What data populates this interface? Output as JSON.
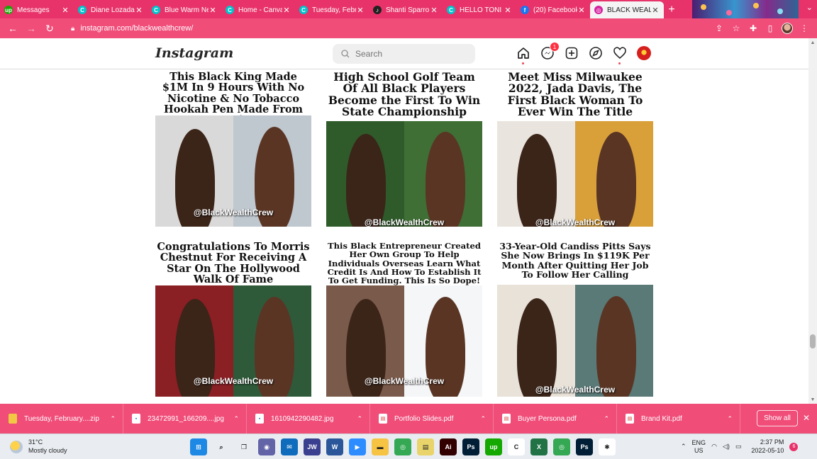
{
  "browser": {
    "tabs": [
      {
        "label": "Messages",
        "favicon": "upwork-icon",
        "color": "#14a800",
        "glyph": "up"
      },
      {
        "label": "Diane Lozada",
        "favicon": "canva-icon",
        "color": "#00c4cc",
        "glyph": "C"
      },
      {
        "label": "Blue Warm Ne",
        "favicon": "canva-icon",
        "color": "#00c4cc",
        "glyph": "C"
      },
      {
        "label": "Home - Canva",
        "favicon": "canva-icon",
        "color": "#00c4cc",
        "glyph": "C"
      },
      {
        "label": "Tuesday, Febr",
        "favicon": "canva-icon",
        "color": "#00c4cc",
        "glyph": "C"
      },
      {
        "label": "Shanti Sparro",
        "favicon": "music-icon",
        "color": "#222222",
        "glyph": "♪"
      },
      {
        "label": "HELLO TONI",
        "favicon": "canva-icon",
        "color": "#00c4cc",
        "glyph": "C"
      },
      {
        "label": "(20) Facebook",
        "favicon": "facebook-icon",
        "color": "#1877f2",
        "glyph": "f"
      },
      {
        "label": "BLACK WEALT",
        "favicon": "instagram-icon",
        "color": "#d6249f",
        "glyph": "◎"
      }
    ],
    "url": "instagram.com/blackwealthcrew/"
  },
  "instagram": {
    "logo": "Instagram",
    "search_placeholder": "Search",
    "messenger_badge": "1"
  },
  "posts": [
    {
      "headline": "This Black King Made $1M In 9 Hours With No Nicotine & No Tobacco Hookah Pen Made From Fruit",
      "watermark": "@BlackWealthCrew",
      "bg_left": "#d9d9d9",
      "bg_right": "#bfc7cf"
    },
    {
      "headline": "High School Golf Team Of All Black Players Become the First To Win State Championship",
      "watermark": "@BlackWealthCrew",
      "bg_left": "#2f5b2a",
      "bg_right": "#3f6f35"
    },
    {
      "headline": "Meet Miss Milwaukee 2022, Jada Davis, The First Black Woman To Ever Win The Title",
      "watermark": "@BlackWealthCrew",
      "bg_left": "#e9e4de",
      "bg_right": "#d9a03a"
    },
    {
      "headline": "Congratulations To Morris Chestnut For Receiving A Star On The Hollywood Walk Of Fame",
      "watermark": "@BlackWealthCrew",
      "bg_left": "#8a1f24",
      "bg_right": "#2e5a3a"
    },
    {
      "headline": "This Black Entrepreneur Created Her Own Group To Help Individuals Overseas Learn What Credit Is And How To Establish It To Get Funding. This Is So Dope!",
      "watermark": "@BlackWealthCrew",
      "bg_left": "#7a5a4a",
      "bg_right": "#f4f6f8"
    },
    {
      "headline": "33-Year-Old Candiss Pitts Says She Now Brings In $119K Per Month After Quitting Her Job To Follow Her Calling",
      "watermark": "@BlackWealthCrew",
      "bg_left": "#e8e2d8",
      "bg_right": "#5a7a78"
    }
  ],
  "downloads": {
    "items": [
      {
        "name": "Tuesday, February....zip",
        "icon": "folder-zip-icon",
        "color": "#f2c744"
      },
      {
        "name": "23472991_166209....jpg",
        "icon": "image-file-icon",
        "color": "#ffffff"
      },
      {
        "name": "1610942290482.jpg",
        "icon": "image-file-icon",
        "color": "#ffffff"
      },
      {
        "name": "Portfolio Slides.pdf",
        "icon": "pdf-file-icon",
        "color": "#ffffff"
      },
      {
        "name": "Buyer Persona.pdf",
        "icon": "pdf-file-icon",
        "color": "#ffffff"
      },
      {
        "name": "Brand Kit.pdf",
        "icon": "pdf-file-icon",
        "color": "#ffffff"
      }
    ],
    "show_all": "Show all"
  },
  "taskbar": {
    "weather_temp": "31°C",
    "weather_desc": "Mostly cloudy",
    "lang_top": "ENG",
    "lang_bottom": "US",
    "time": "2:37 PM",
    "date": "2022-05-10",
    "notifications": "6",
    "apps": [
      {
        "name": "windows-start-icon",
        "color": "#1e88e5",
        "glyph": "⊞"
      },
      {
        "name": "search-icon",
        "color": "#e9edf2",
        "glyph": "⌕"
      },
      {
        "name": "task-view-icon",
        "color": "#e9edf2",
        "glyph": "❐"
      },
      {
        "name": "teams-chat-icon",
        "color": "#6264a7",
        "glyph": "◉"
      },
      {
        "name": "mail-icon",
        "color": "#0f6cbd",
        "glyph": "✉"
      },
      {
        "name": "jw-icon",
        "color": "#3b3f8f",
        "glyph": "JW"
      },
      {
        "name": "word-icon",
        "color": "#2b579a",
        "glyph": "W"
      },
      {
        "name": "zoom-icon",
        "color": "#2d8cff",
        "glyph": "▶"
      },
      {
        "name": "file-explorer-icon",
        "color": "#f6c343",
        "glyph": "▬"
      },
      {
        "name": "chrome-icon",
        "color": "#34a853",
        "glyph": "◎"
      },
      {
        "name": "notepad-icon",
        "color": "#e8d46a",
        "glyph": "▤"
      },
      {
        "name": "illustrator-icon",
        "color": "#330000",
        "glyph": "Ai"
      },
      {
        "name": "photoshop-icon",
        "color": "#001e36",
        "glyph": "Ps"
      },
      {
        "name": "upwork-icon",
        "color": "#14a800",
        "glyph": "up"
      },
      {
        "name": "cc-icon",
        "color": "#ffffff",
        "glyph": "C"
      },
      {
        "name": "excel-icon",
        "color": "#217346",
        "glyph": "X"
      },
      {
        "name": "chrome-profile-icon",
        "color": "#34a853",
        "glyph": "◎"
      },
      {
        "name": "photoshop-icon-2",
        "color": "#001e36",
        "glyph": "Ps"
      },
      {
        "name": "slack-icon",
        "color": "#ffffff",
        "glyph": "✱"
      }
    ]
  },
  "colors": {
    "accent": "#e8336a",
    "toolbar": "#f04d79"
  }
}
